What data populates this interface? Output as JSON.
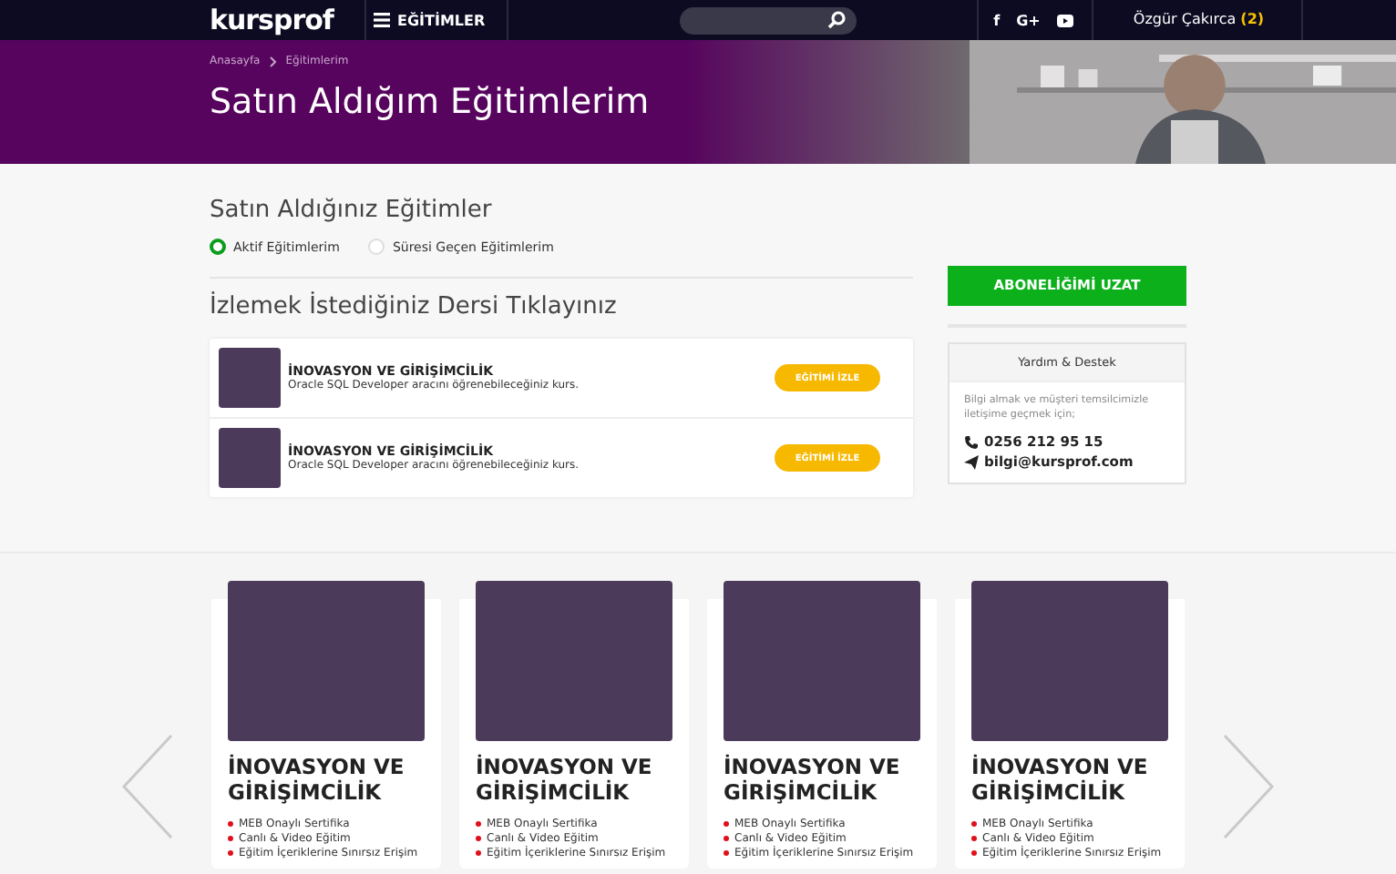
{
  "header": {
    "logo": "kursprof",
    "menu_label": "EĞİTİMLER",
    "social": [
      {
        "kind": "facebook",
        "label": "f"
      },
      {
        "kind": "googleplus",
        "label": "G+"
      },
      {
        "kind": "youtube"
      }
    ],
    "user": {
      "name": "Özgür Çakırca",
      "count": "(2)"
    }
  },
  "banner": {
    "breadcrumb": [
      "Anasayfa",
      "Eğitimlerim"
    ],
    "title": "Satın Aldığım Eğitimlerim"
  },
  "purchased": {
    "title": "Satın Aldığınız Eğitimler",
    "filters": [
      {
        "label": "Aktif Eğitimlerim",
        "selected": true
      },
      {
        "label": "Süresi Geçen Eğitimlerim",
        "selected": false
      }
    ]
  },
  "lessons": {
    "title": "İzlemek İstediğiniz Dersi Tıklayınız",
    "items": [
      {
        "title": "İNOVASYON VE GİRİŞİMCİLİK",
        "description": "Oracle SQL Developer aracını öğrenebileceğiniz kurs.",
        "button": "EĞİTİMİ İZLE"
      },
      {
        "title": "İNOVASYON VE GİRİŞİMCİLİK",
        "description": "Oracle SQL Developer aracını öğrenebileceğiniz kurs.",
        "button": "EĞİTİMİ İZLE"
      }
    ]
  },
  "subscribe_button": "ABONELİĞİMİ UZAT",
  "support": {
    "title": "Yardım & Destek",
    "text": "Bilgi almak ve müşteri temsilcimizle iletişime geçmek için;",
    "phone": "0256 212 95 15",
    "email": "bilgi@kursprof.com"
  },
  "carousel": [
    {
      "title": "İNOVASYON VE GİRİŞİMCİLİK",
      "features": [
        "MEB Onaylı Sertifika",
        "Canlı & Video Eğitim",
        "Eğitim İçeriklerine Sınırsız Erişim"
      ]
    },
    {
      "title": "İNOVASYON VE GİRİŞİMCİLİK",
      "features": [
        "MEB Onaylı Sertifika",
        "Canlı & Video Eğitim",
        "Eğitim İçeriklerine Sınırsız Erişim"
      ]
    },
    {
      "title": "İNOVASYON VE GİRİŞİMCİLİK",
      "features": [
        "MEB Onaylı Sertifika",
        "Canlı & Video Eğitim",
        "Eğitim İçeriklerine Sınırsız Erişim"
      ]
    },
    {
      "title": "İNOVASYON VE GİRİŞİMCİLİK",
      "features": [
        "MEB Onaylı Sertifika",
        "Canlı & Video Eğitim",
        "Eğitim İçeriklerine Sınırsız Erişim"
      ]
    }
  ]
}
